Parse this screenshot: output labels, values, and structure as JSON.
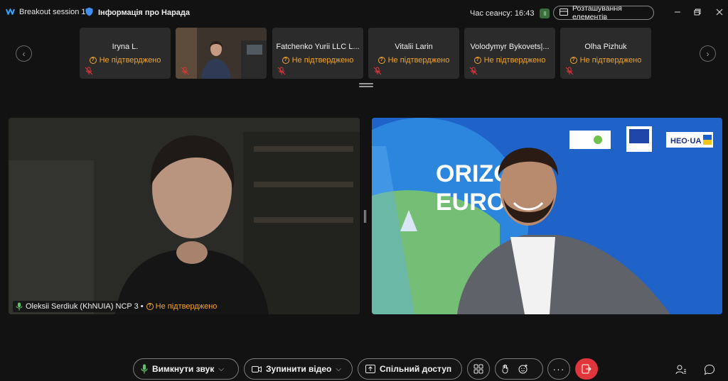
{
  "window": {
    "session_title": "Breakout session 1",
    "info_label": "Інформація про Нарада",
    "session_time_label": "Час сеансу: 16:43",
    "session_badge": "ll",
    "layout_button": "Розташування елементів",
    "controls": [
      "minimize-icon",
      "restore-icon",
      "close-icon"
    ]
  },
  "filmstrip": {
    "tiles": [
      {
        "name": "Iryna L.",
        "status": "Не підтверджено",
        "has_video": false
      },
      {
        "name": "",
        "status": "",
        "has_video": true
      },
      {
        "name": "Fatchenko Yurii LLC L...",
        "status": "Не підтверджено",
        "has_video": false
      },
      {
        "name": "Vitalii Larin",
        "status": "Не підтверджено",
        "has_video": false
      },
      {
        "name": "Volodymyr Bykovets|...",
        "status": "Не підтверджено",
        "has_video": false
      },
      {
        "name": "Olha Pizhuk",
        "status": "Не підтверджено",
        "has_video": false
      }
    ],
    "prev_icon": "chevron-left-icon",
    "next_icon": "chevron-right-icon"
  },
  "main": {
    "left_participant": "Oleksii Serdiuk (KhNUIA) NCP 3 •",
    "left_status": "Не підтверджено",
    "right_background_text": {
      "line1": "ORIZON",
      "line2": "EUROPE",
      "logo_right": "HEO·UA",
      "logo_eu_caption": "Funded by the European Union"
    }
  },
  "toolbar": {
    "mute_label": "Вимкнути звук",
    "stop_video_label": "Зупинити відео",
    "share_label": "Спільний доступ",
    "buttons": [
      "layout-grid-icon",
      "raise-hand-icon",
      "reactions-icon",
      "more-icon",
      "leave-icon"
    ],
    "right_icons": [
      "participants-icon",
      "chat-icon"
    ]
  },
  "colors": {
    "accent_status": "#f2a52b",
    "leave_red": "#e0353b",
    "background": "#121212",
    "tile": "#2b2b2b"
  }
}
